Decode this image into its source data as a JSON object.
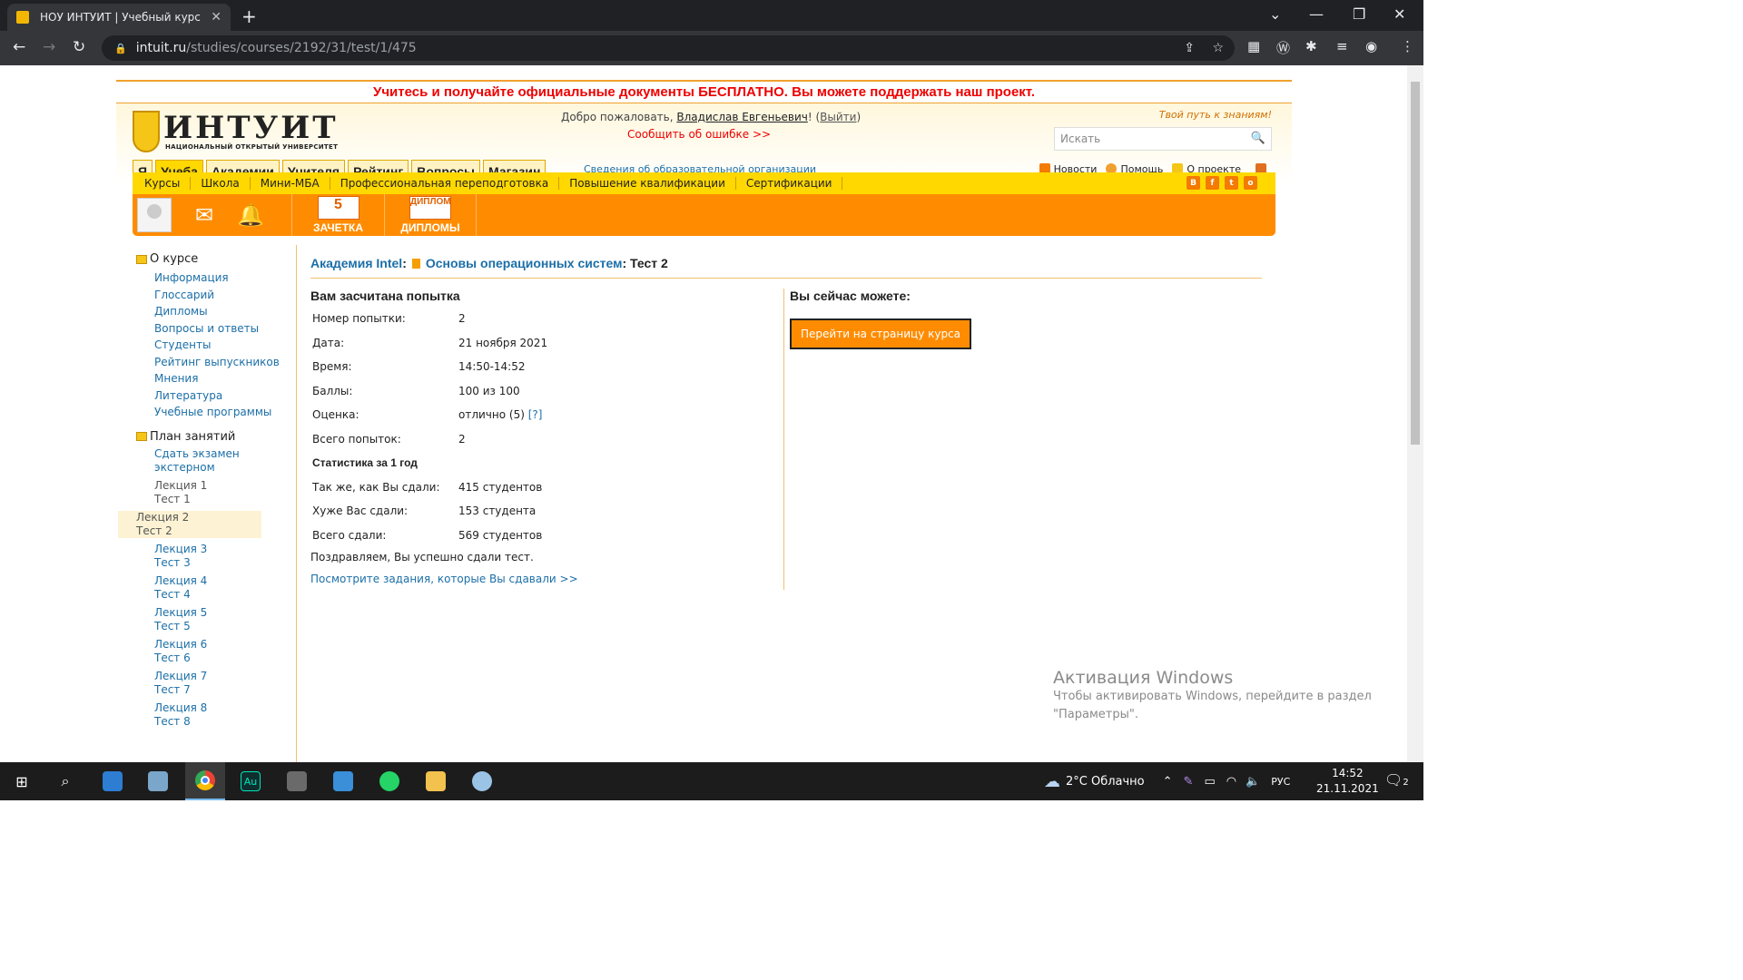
{
  "browser": {
    "tab_title": "НОУ ИНТУИТ | Учебный курс | О",
    "url_host": "intuit.ru",
    "url_path": "/studies/courses/2192/31/test/1/475"
  },
  "promo": "Учитесь и получайте официальные документы БЕСПЛАТНО. Вы можете поддержать наш проект.",
  "header": {
    "logo_name": "ИНТУИТ",
    "logo_sub": "НАЦИОНАЛЬНЫЙ ОТКРЫТЫЙ УНИВЕРСИТЕТ",
    "welcome_prefix": "Добро пожаловать,",
    "user": "Владислав Евгеньевич",
    "welcome_mid": "! (",
    "logout": "Выйти",
    "welcome_end": ")",
    "report_error": "Сообщить об ошибке >>",
    "slogan": "Твой путь к знаниям!",
    "search_placeholder": "Искать"
  },
  "tabs": [
    "Я",
    "Учеба",
    "Академии",
    "Учителя",
    "Рейтинг",
    "Вопросы",
    "Магазин"
  ],
  "org_info": "Сведения об образовательной организации",
  "toplinks": {
    "news": "Новости",
    "help": "Помощь",
    "about": "О проекте"
  },
  "subnav": [
    "Курсы",
    "Школа",
    "Мини-МБА",
    "Профессиональная переподготовка",
    "Повышение квалификации",
    "Сертификации"
  ],
  "socials": [
    "В",
    "f",
    "t",
    "о"
  ],
  "orangebar": {
    "zachetka": "ЗАЧЕТКА",
    "diplomy": "ДИПЛОМЫ",
    "zachetka_icon": "5",
    "diploma_icon": "ДИПЛОМ"
  },
  "sidebar": {
    "about_header": "О курсе",
    "about_links": [
      "Информация",
      "Глоссарий",
      "Дипломы",
      "Вопросы и ответы",
      "Студенты",
      "Рейтинг выпускников",
      "Мнения",
      "Литература",
      "Учебные программы"
    ],
    "plan_header": "План занятий",
    "exam": "Сдать экзамен экстерном",
    "lessons": [
      [
        "Лекция 1",
        "Тест 1"
      ],
      [
        "Лекция 2",
        "Тест 2"
      ],
      [
        "Лекция 3",
        "Тест 3"
      ],
      [
        "Лекция 4",
        "Тест 4"
      ],
      [
        "Лекция 5",
        "Тест 5"
      ],
      [
        "Лекция 6",
        "Тест 6"
      ],
      [
        "Лекция 7",
        "Тест 7"
      ],
      [
        "Лекция 8",
        "Тест 8"
      ]
    ]
  },
  "main": {
    "bc_academy": "Академия Intel",
    "bc_sep": ":",
    "bc_course": "Основы операционных систем",
    "bc_test": ": Тест 2",
    "result_title": "Вам засчитана попытка",
    "rows": [
      [
        "Номер попытки:",
        "2"
      ],
      [
        "Дата:",
        "21 ноября 2021"
      ],
      [
        "Время:",
        "14:50-14:52"
      ],
      [
        "Баллы:",
        "100 из 100"
      ]
    ],
    "grade_label": "Оценка:",
    "grade_value": "отлично (5)",
    "grade_help": "[?]",
    "total_label": "Всего попыток:",
    "total_value": "2",
    "stats_title": "Статистика за 1 год",
    "stats": [
      [
        "Так же, как Вы сдали:",
        "415 студентов"
      ],
      [
        "Хуже Вас сдали:",
        "153 студента"
      ],
      [
        "Всего сдали:",
        "569 студентов"
      ]
    ],
    "congrats": "Поздравляем, Вы успешно сдали тест.",
    "view_tasks": "Посмотрите задания, которые Вы сдавали >>",
    "now_title": "Вы сейчас можете:",
    "go_course": "Перейти на страницу курса"
  },
  "watermark": {
    "title": "Активация Windows",
    "line1": "Чтобы активировать Windows, перейдите в раздел",
    "line2": "\"Параметры\"."
  },
  "taskbar": {
    "weather": "2°C Облачно",
    "lang": "РУС",
    "time": "14:52",
    "date": "21.11.2021",
    "notifications": "2"
  }
}
